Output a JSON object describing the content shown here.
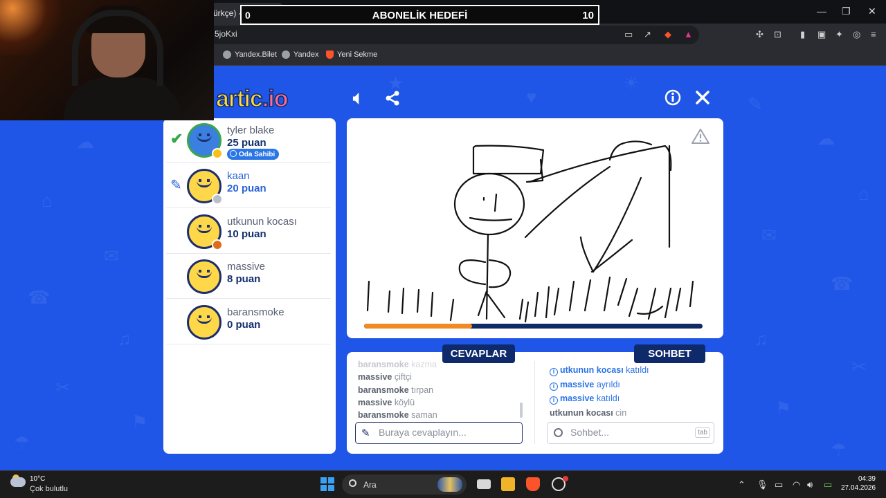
{
  "browser": {
    "tab_title": "ürkçe) - Gartic.io",
    "tab_close": "✕",
    "new_tab": "+",
    "url": "5joKxi",
    "bookmarks": [
      "Yandex.Bilet",
      "Yandex",
      "Yeni Sekme"
    ],
    "window_controls": [
      "—",
      "❐",
      "✕"
    ]
  },
  "overlay": {
    "goal_label": "ABONELİK HEDEFİ",
    "goal_current": "0",
    "goal_target": "10"
  },
  "game": {
    "logo_text": "artic",
    "logo_suffix": ".io",
    "players": [
      {
        "name": "tyler blake",
        "score": "25 puan",
        "badge": "Oda Sahibi",
        "status_color": "#f5c21b",
        "state": "guessed"
      },
      {
        "name": "kaan",
        "score": "20 puan",
        "status_color": "#b9bec8",
        "state": "drawing"
      },
      {
        "name": "utkunun kocası",
        "score": "10 puan",
        "status_color": "#e06c1a",
        "state": ""
      },
      {
        "name": "massive",
        "score": "8 puan",
        "state": ""
      },
      {
        "name": "baransmoke",
        "score": "0 puan",
        "state": ""
      }
    ],
    "timer_progress": 0.32,
    "answers_tab": "CEVAPLAR",
    "chat_tab": "SOHBET",
    "answers": [
      {
        "user": "baransmoke",
        "text": "kazma"
      },
      {
        "user": "massive",
        "text": "çiftçi"
      },
      {
        "user": "baransmoke",
        "text": "tırpan"
      },
      {
        "user": "massive",
        "text": "köylü"
      },
      {
        "user": "baransmoke",
        "text": "saman"
      }
    ],
    "chat": [
      {
        "user": "utkunun kocası",
        "text": "katıldı",
        "system": true
      },
      {
        "user": "massive",
        "text": "ayrıldı",
        "system": true
      },
      {
        "user": "massive",
        "text": "katıldı",
        "system": true
      },
      {
        "user": "utkunun kocası",
        "text": "cin",
        "system": false
      }
    ],
    "answer_placeholder": "Buraya cevaplayın...",
    "chat_placeholder": "Sohbet...",
    "chat_tab_hint": "tab"
  },
  "taskbar": {
    "temperature": "10°C",
    "weather": "Çok bulutlu",
    "search_label": "Ara",
    "time": "04:39",
    "date": "27.04.2026"
  }
}
